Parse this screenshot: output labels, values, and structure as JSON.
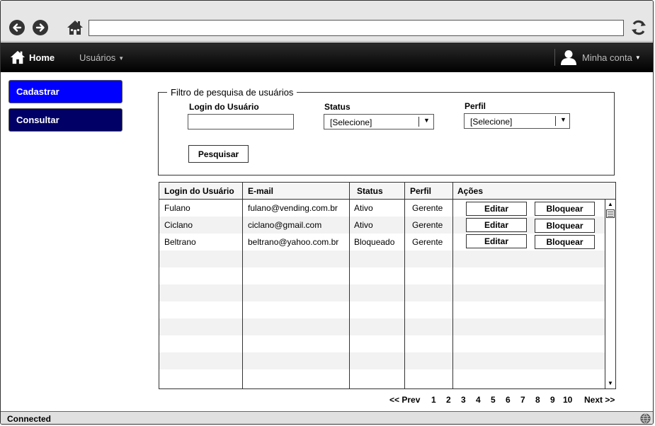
{
  "browser": {
    "url": "",
    "back_icon": "back-arrow-icon",
    "forward_icon": "forward-arrow-icon",
    "home_icon": "home-icon",
    "refresh_icon": "refresh-icon"
  },
  "navbar": {
    "home_label": "Home",
    "users_label": "Usuários",
    "account_label": "Minha conta"
  },
  "sidebar": {
    "items": [
      {
        "label": "Cadastrar",
        "color": "#0000ff"
      },
      {
        "label": "Consultar",
        "color": "#000066"
      }
    ]
  },
  "filter": {
    "legend": "Filtro de pesquisa de usuários",
    "login_label": "Login do Usuário",
    "login_value": "",
    "status_label": "Status",
    "status_value": "[Selecione]",
    "profile_label": "Perfil",
    "profile_value": "[Selecione]",
    "search_button": "Pesquisar"
  },
  "table": {
    "columns": [
      "Login do Usuário",
      "E-mail",
      "Status",
      "Perfil",
      "Ações"
    ],
    "rows": [
      {
        "login": "Fulano",
        "email": "fulano@vending.com.br",
        "status": "Ativo",
        "profile": "Gerente",
        "edit": "Editar",
        "block": "Bloquear"
      },
      {
        "login": "Ciclano",
        "email": "ciclano@gmail.com",
        "status": "Ativo",
        "profile": "Gerente",
        "edit": "Editar",
        "block": "Bloquear"
      },
      {
        "login": "Beltrano",
        "email": "beltrano@yahoo.com.br",
        "status": "Bloqueado",
        "profile": "Gerente",
        "edit": "Editar",
        "block": "Bloquear"
      }
    ]
  },
  "pagination": {
    "prev": "<< Prev",
    "pages": [
      "1",
      "2",
      "3",
      "4",
      "5",
      "6",
      "7",
      "8",
      "9",
      "10"
    ],
    "next": "Next >>"
  },
  "statusbar": {
    "text": "Connected"
  }
}
